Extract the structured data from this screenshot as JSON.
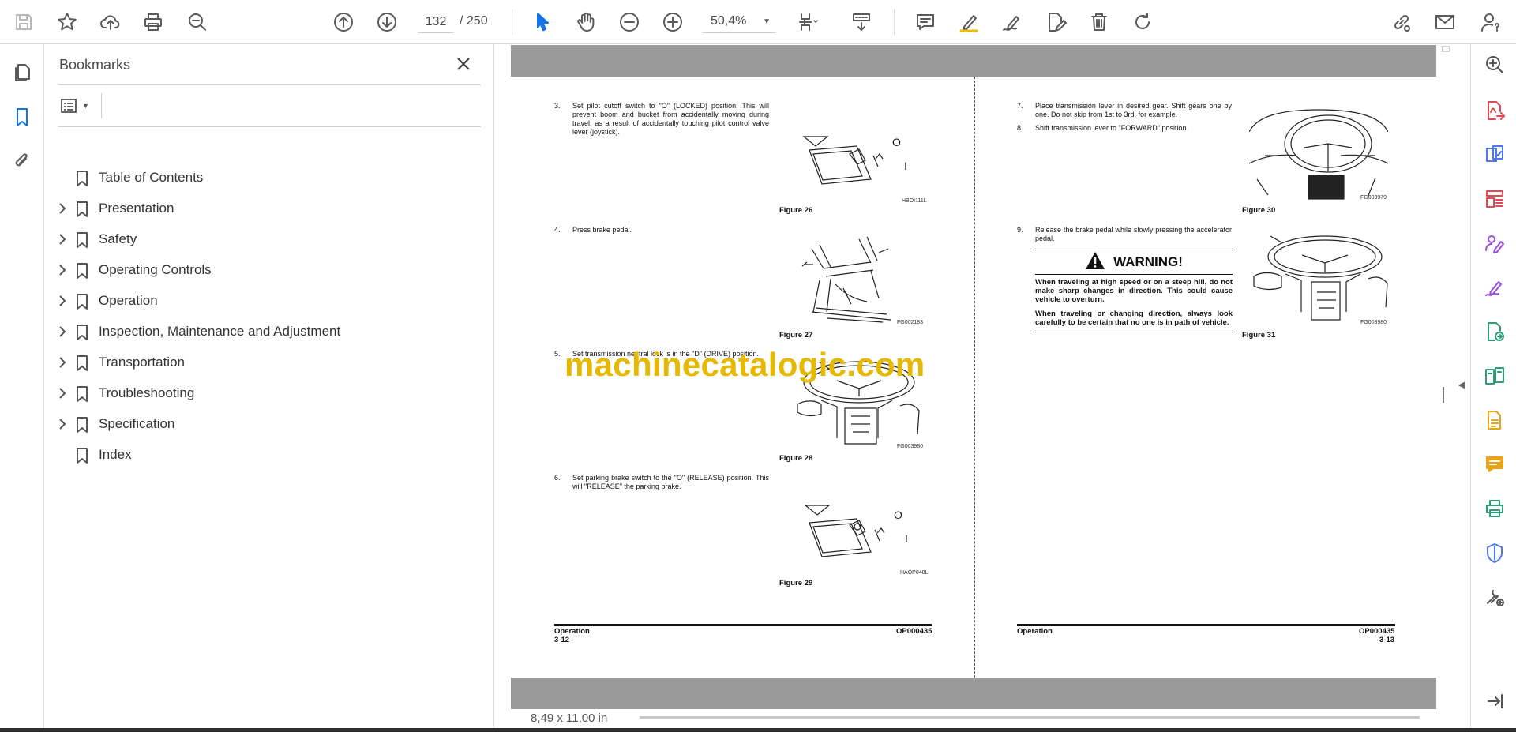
{
  "toolbar": {
    "current_page": "132",
    "total_pages": "/ 250",
    "zoom": "50,4%"
  },
  "bookmarks": {
    "title": "Bookmarks",
    "items": [
      {
        "label": "Table of Contents",
        "expandable": false
      },
      {
        "label": "Presentation",
        "expandable": true
      },
      {
        "label": "Safety",
        "expandable": true
      },
      {
        "label": "Operating Controls",
        "expandable": true
      },
      {
        "label": "Operation",
        "expandable": true
      },
      {
        "label": "Inspection, Maintenance and Adjustment",
        "expandable": true
      },
      {
        "label": "Transportation",
        "expandable": true
      },
      {
        "label": "Troubleshooting",
        "expandable": true
      },
      {
        "label": "Specification",
        "expandable": true
      },
      {
        "label": "Index",
        "expandable": false
      }
    ]
  },
  "status": {
    "page_size": "8,49 x 11,00 in"
  },
  "watermark": "machinecatalogic.com",
  "left_page": {
    "steps": [
      {
        "num": "3.",
        "text": "Set pilot cutoff switch to \"O\" (LOCKED) position. This will prevent boom and bucket from accidentally moving during travel, as a result of accidentally touching pilot control valve lever (joystick)."
      },
      {
        "num": "4.",
        "text": "Press brake pedal."
      },
      {
        "num": "5.",
        "text": "Set transmission neutral lock is in the \"D\" (DRIVE) position."
      },
      {
        "num": "6.",
        "text": "Set parking brake switch to the \"O\" (RELEASE) position. This will \"RELEASE\" the parking brake."
      }
    ],
    "figures": [
      {
        "caption": "Figure 26",
        "code": "HBOI111L"
      },
      {
        "caption": "Figure 27",
        "code": "FG002183"
      },
      {
        "caption": "Figure 28",
        "code": "FG003980"
      },
      {
        "caption": "Figure 29",
        "code": "HAOP048L"
      }
    ],
    "footer_left": "Operation",
    "footer_page": "3-12",
    "footer_right": "OP000435"
  },
  "right_page": {
    "steps": [
      {
        "num": "7.",
        "text": "Place transmission lever in desired gear. Shift gears one by one. Do not skip from 1st to 3rd, for example."
      },
      {
        "num": "8.",
        "text": "Shift transmission lever to \"FORWARD\" position."
      },
      {
        "num": "9.",
        "text": "Release the brake pedal while slowly pressing the accelerator pedal."
      }
    ],
    "warning": {
      "title": "WARNING!",
      "para1": "When traveling at high speed or on a steep hill, do not make sharp changes in direction. This could cause vehicle to overturn.",
      "para2": "When traveling or changing direction, always look carefully to be certain that no one is in path of vehicle."
    },
    "figures": [
      {
        "caption": "Figure 30",
        "code": "FG003979"
      },
      {
        "caption": "Figure 31",
        "code": "FG003980"
      }
    ],
    "footer_left": "Operation",
    "footer_page": "3-13",
    "footer_right": "OP000435"
  },
  "right_rail_colors": [
    "#e34850",
    "#4b7bec",
    "#e34850",
    "#9b4de0",
    "#9b4de0",
    "#2d9d78",
    "#2d9d78",
    "#e8a317",
    "#e8a317",
    "#2d9d78",
    "#4b7bec",
    "#555555"
  ]
}
